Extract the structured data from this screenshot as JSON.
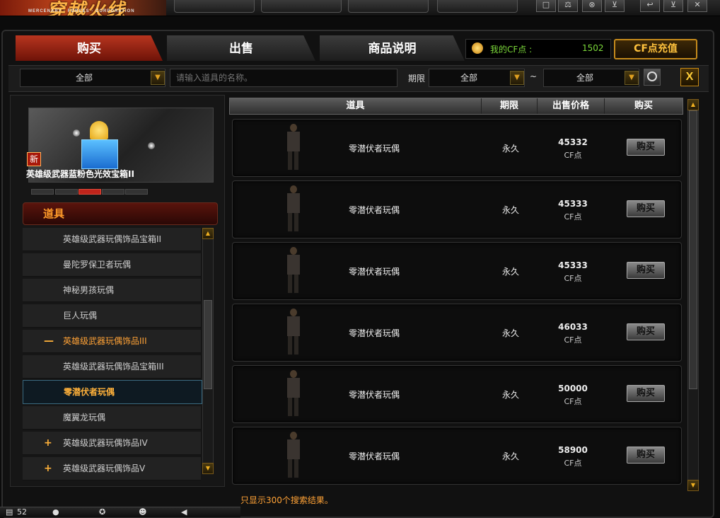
{
  "tabs": {
    "buy": "购买",
    "sell": "出售",
    "desc": "商品说明"
  },
  "cf": {
    "label": "我的CF点 :",
    "value": "1502",
    "recharge": "CF点充值"
  },
  "search": {
    "category": "全部",
    "placeholder": "请输入道具的名称。",
    "period_label": "期限",
    "from": "全部",
    "tilde": "~",
    "to": "全部",
    "close": "X"
  },
  "featured": {
    "new_tag": "新",
    "name": "英雄级武器蓝粉色光效宝箱II"
  },
  "category": {
    "title": "道具",
    "items": [
      {
        "label": "英雄级武器玩偶饰品宝箱II",
        "mark": ""
      },
      {
        "label": "曼陀罗保卫者玩偶",
        "mark": ""
      },
      {
        "label": "神秘男孩玩偶",
        "mark": ""
      },
      {
        "label": "巨人玩偶",
        "mark": ""
      },
      {
        "label": "英雄级武器玩偶饰品III",
        "mark": "—"
      },
      {
        "label": "英雄级武器玩偶饰品宝箱III",
        "mark": ""
      },
      {
        "label": "零潜伏者玩偶",
        "mark": ""
      },
      {
        "label": "魔翼龙玩偶",
        "mark": ""
      },
      {
        "label": "英雄级武器玩偶饰品IV",
        "mark": "+"
      },
      {
        "label": "英雄级武器玩偶饰品V",
        "mark": "+"
      }
    ]
  },
  "table": {
    "headers": [
      "道具",
      "期限",
      "出售价格",
      "购买"
    ],
    "rows": [
      {
        "name": "零潜伏者玩偶",
        "period": "永久",
        "price": "45332",
        "unit": "CF点",
        "buy": "购买"
      },
      {
        "name": "零潜伏者玩偶",
        "period": "永久",
        "price": "45333",
        "unit": "CF点",
        "buy": "购买"
      },
      {
        "name": "零潜伏者玩偶",
        "period": "永久",
        "price": "45333",
        "unit": "CF点",
        "buy": "购买"
      },
      {
        "name": "零潜伏者玩偶",
        "period": "永久",
        "price": "46033",
        "unit": "CF点",
        "buy": "购买"
      },
      {
        "name": "零潜伏者玩偶",
        "period": "永久",
        "price": "50000",
        "unit": "CF点",
        "buy": "购买"
      },
      {
        "name": "零潜伏者玩偶",
        "period": "永久",
        "price": "58900",
        "unit": "CF点",
        "buy": "购买"
      }
    ]
  },
  "footnote": "只显示300个搜索结果。",
  "status": {
    "level": "52"
  }
}
